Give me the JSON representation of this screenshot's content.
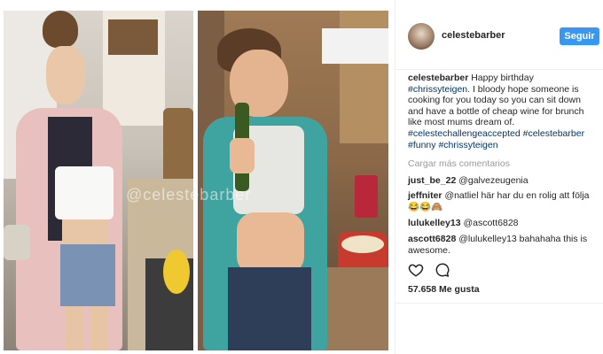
{
  "post": {
    "username": "celestebarber",
    "follow_label": "Seguir",
    "watermark": "@celestebarber",
    "caption": {
      "author": "celestebarber",
      "text_parts": [
        {
          "type": "text",
          "value": "Happy birthday "
        },
        {
          "type": "tag",
          "value": "#chrissyteigen"
        },
        {
          "type": "text",
          "value": ". I bloody hope someone is cooking for you today so you can sit down and have a bottle of cheap wine for brunch like most mums dream of. "
        },
        {
          "type": "tag",
          "value": "#celestechallengeaccepted"
        },
        {
          "type": "text",
          "value": " "
        },
        {
          "type": "tag",
          "value": "#celestebarber"
        },
        {
          "type": "text",
          "value": " "
        },
        {
          "type": "tag",
          "value": "#funny"
        },
        {
          "type": "text",
          "value": " "
        },
        {
          "type": "tag",
          "value": "#chrissyteigen"
        }
      ]
    },
    "load_more": "Cargar más comentarios",
    "comments": [
      {
        "user": "just_be_22",
        "text": "@galvezeugenia"
      },
      {
        "user": "jeffniter",
        "text": "@natliel här har du en rolig att följa😂😂🙈"
      },
      {
        "user": "lulukelley13",
        "text": "@ascott6828"
      },
      {
        "user": "ascott6828",
        "text": "@lulukelley13 bahahaha this is awesome."
      }
    ],
    "likes": "57.658 Me gusta"
  },
  "icons": {
    "like": "heart-outline-icon",
    "comment": "speech-bubble-icon"
  },
  "colors": {
    "accent": "#3897f0",
    "tag": "#003569",
    "muted": "#999999"
  }
}
